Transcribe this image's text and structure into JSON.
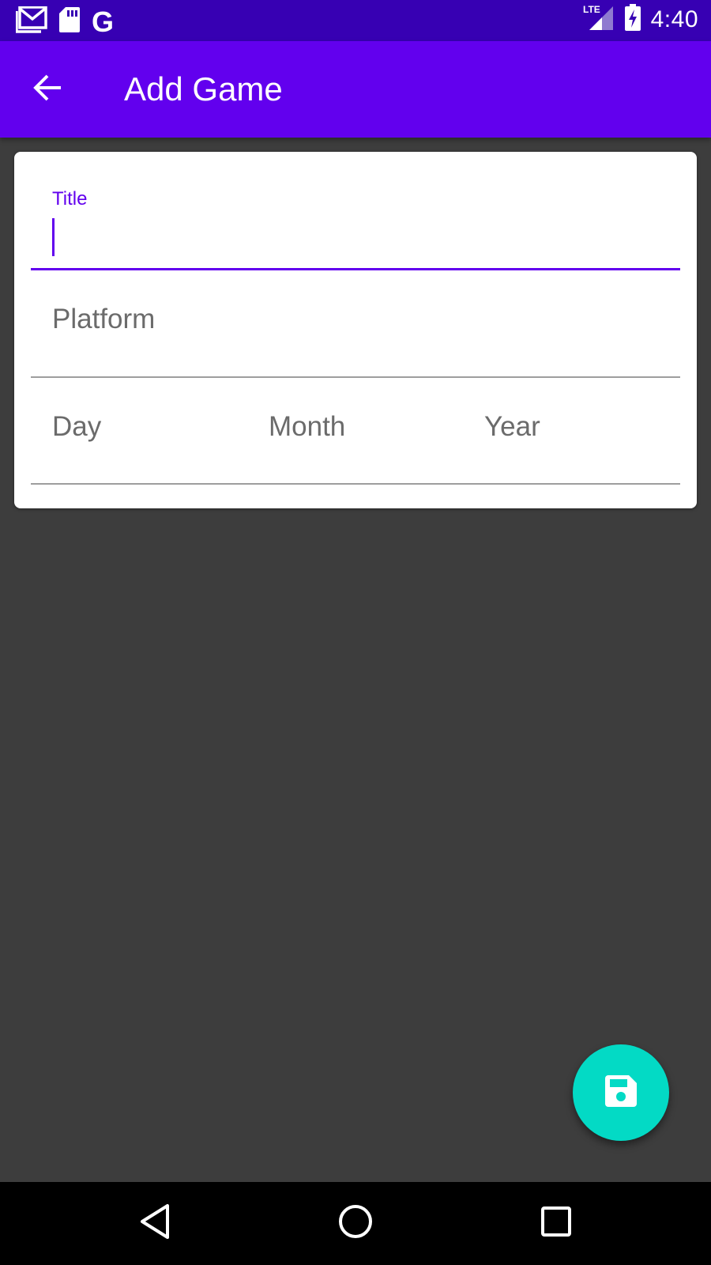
{
  "status_bar": {
    "time": "4:40",
    "network": "LTE",
    "left_icons": [
      "gmail-icon",
      "sd-card-icon",
      "google-icon"
    ],
    "google_letter": "G"
  },
  "app_bar": {
    "title": "Add Game",
    "back_icon": "arrow-back-icon",
    "color": "#6200ee"
  },
  "form": {
    "title_field": {
      "label": "Title",
      "value": ""
    },
    "platform_field": {
      "placeholder": "Platform",
      "value": ""
    },
    "date_fields": {
      "day": "Day",
      "month": "Month",
      "year": "Year"
    }
  },
  "fab": {
    "icon": "save-icon",
    "color": "#03dac5"
  },
  "nav_bar": {
    "icons": [
      "nav-back-icon",
      "nav-home-icon",
      "nav-recents-icon"
    ]
  },
  "colors": {
    "status_bar": "#3700b3",
    "accent": "#6200ee",
    "background": "#3d3d3d"
  }
}
